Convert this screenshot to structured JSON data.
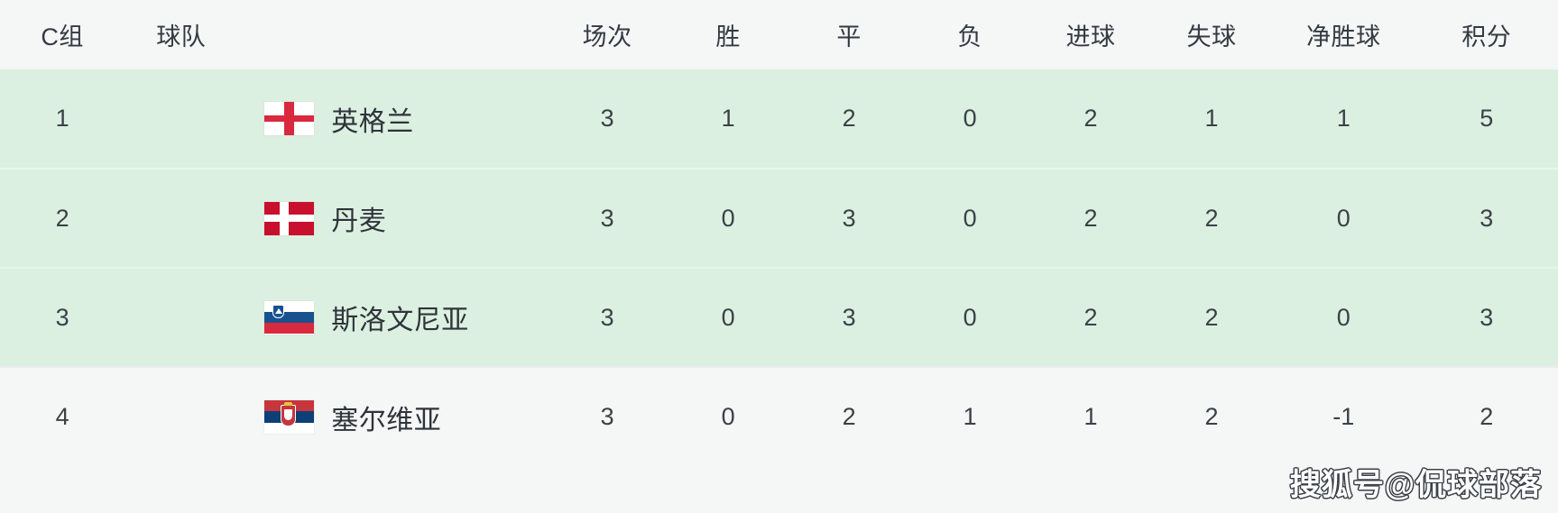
{
  "table": {
    "columns": [
      {
        "key": "rank",
        "label": "C组"
      },
      {
        "key": "team",
        "label": "球队"
      },
      {
        "key": "played",
        "label": "场次"
      },
      {
        "key": "won",
        "label": "胜"
      },
      {
        "key": "drawn",
        "label": "平"
      },
      {
        "key": "lost",
        "label": "负"
      },
      {
        "key": "gf",
        "label": "进球"
      },
      {
        "key": "ga",
        "label": "失球"
      },
      {
        "key": "gd",
        "label": "净胜球"
      },
      {
        "key": "points",
        "label": "积分"
      }
    ],
    "rows": [
      {
        "rank": "1",
        "team": "英格兰",
        "flag": "england-flag",
        "played": "3",
        "won": "1",
        "drawn": "2",
        "lost": "0",
        "gf": "2",
        "ga": "1",
        "gd": "1",
        "points": "5",
        "status": "qualified"
      },
      {
        "rank": "2",
        "team": "丹麦",
        "flag": "denmark-flag",
        "played": "3",
        "won": "0",
        "drawn": "3",
        "lost": "0",
        "gf": "2",
        "ga": "2",
        "gd": "0",
        "points": "3",
        "status": "qualified"
      },
      {
        "rank": "3",
        "team": "斯洛文尼亚",
        "flag": "slovenia-flag",
        "played": "3",
        "won": "0",
        "drawn": "3",
        "lost": "0",
        "gf": "2",
        "ga": "2",
        "gd": "0",
        "points": "3",
        "status": "qualified"
      },
      {
        "rank": "4",
        "team": "塞尔维亚",
        "flag": "serbia-flag",
        "played": "3",
        "won": "0",
        "drawn": "2",
        "lost": "1",
        "gf": "1",
        "ga": "2",
        "gd": "-1",
        "points": "2",
        "status": "eliminated"
      }
    ]
  },
  "watermark": {
    "text": "搜狐号@侃球部落"
  },
  "colors": {
    "qualified_row_bg": "#dcf0e1",
    "eliminated_row_bg": "#f5f6f6",
    "header_bg": "#f5f6f6",
    "text": "#3b4148"
  }
}
